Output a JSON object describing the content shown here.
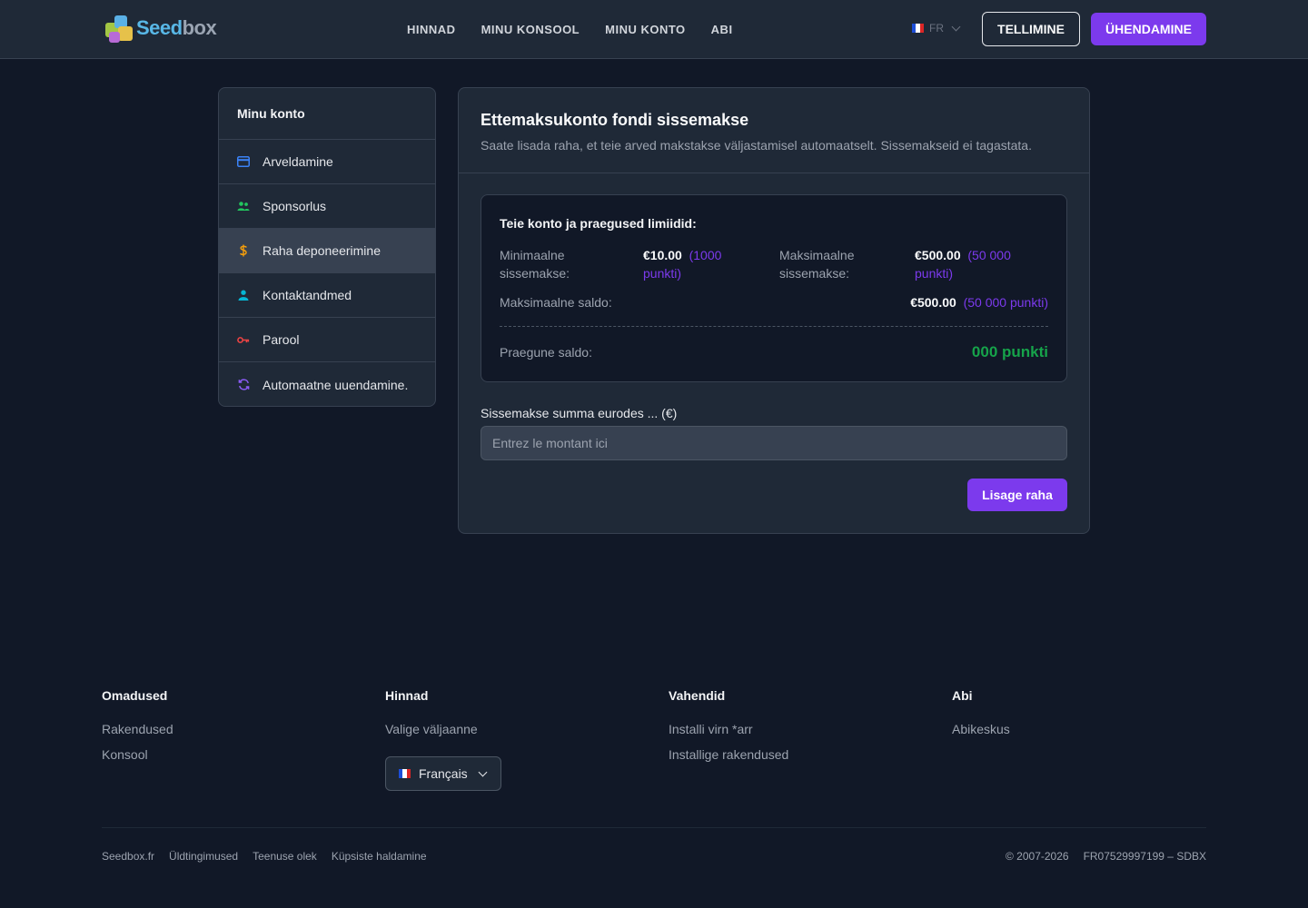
{
  "header": {
    "logo": {
      "part1": "Seed",
      "part2": "box"
    },
    "nav": [
      "HINNAD",
      "MINU KONSOOL",
      "MINU KONTO",
      "ABI"
    ],
    "language": "FR",
    "order_label": "TELLIMINE",
    "login_label": "ÜHENDAMINE"
  },
  "sidebar": {
    "title": "Minu konto",
    "items": [
      {
        "label": "Arveldamine",
        "icon": "credit-card-icon",
        "color": "#3b82f6"
      },
      {
        "label": "Sponsorlus",
        "icon": "users-icon",
        "color": "#22c55e"
      },
      {
        "label": "Raha deponeerimine",
        "icon": "dollar-icon",
        "color": "#f59e0b",
        "active": true
      },
      {
        "label": "Kontaktandmed",
        "icon": "user-icon",
        "color": "#06b6d4"
      },
      {
        "label": "Parool",
        "icon": "key-icon",
        "color": "#ef4444"
      },
      {
        "label": "Automaatne uuendamine.",
        "icon": "refresh-icon",
        "color": "#8b5cf6"
      }
    ]
  },
  "main": {
    "title": "Ettemaksukonto fondi sissemakse",
    "subtitle": "Saate lisada raha, et teie arved makstakse väljastamisel automaatselt. Sissemakseid ei tagastata.",
    "limits": {
      "title": "Teie konto ja praegused limiidid:",
      "min_label_1": "Minimaalne",
      "min_label_2": "sissemakse:",
      "min_value": "€10.00",
      "min_points_1": "(1000",
      "min_points_2": "punkti)",
      "max_label_1": "Maksimaalne",
      "max_label_2": "sissemakse:",
      "max_value": "€500.00",
      "max_points_1": "(50 000",
      "max_points_2": "punkti)",
      "max_balance_label": "Maksimaalne saldo:",
      "max_balance_value": "€500.00",
      "max_balance_points": "(50 000 punkti)",
      "current_label": "Praegune saldo:",
      "current_value": "000 punkti"
    },
    "amount_label": "Sissemakse summa eurodes ... (€)",
    "amount_placeholder": "Entrez le montant ici",
    "add_button": "Lisage raha"
  },
  "footer": {
    "columns": [
      {
        "title": "Omadused",
        "links": [
          "Rakendused",
          "Konsool"
        ]
      },
      {
        "title": "Hinnad",
        "links": [
          "Valige väljaanne"
        ]
      },
      {
        "title": "Vahendid",
        "links": [
          "Installi virn *arr",
          "Installige rakendused"
        ]
      },
      {
        "title": "Abi",
        "links": [
          "Abikeskus"
        ]
      }
    ],
    "language_select": "Français",
    "bottom_links": [
      "Seedbox.fr",
      "Üldtingimused",
      "Teenuse olek",
      "Küpsiste haldamine"
    ],
    "copyright": "© 2007-2026",
    "company_id": "FR07529997199 – SDBX"
  },
  "colors": {
    "accent": "#7c3aed",
    "balance": "#16a34a",
    "background": "#111827",
    "card": "#1f2937"
  }
}
